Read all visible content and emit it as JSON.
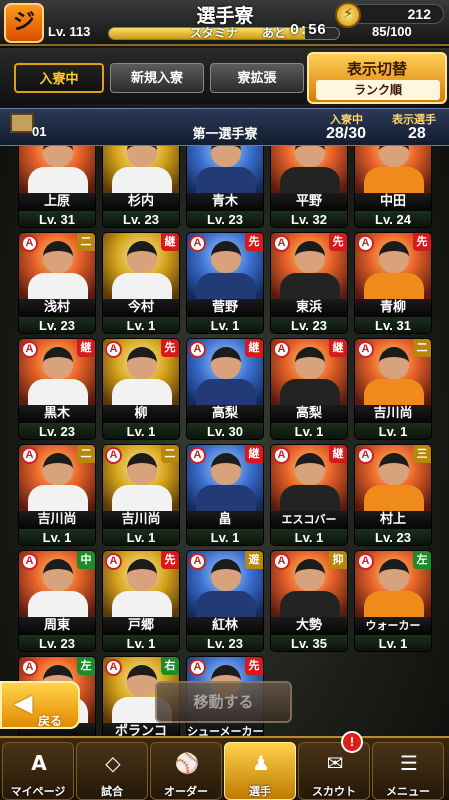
{
  "header": {
    "logo": "ジ",
    "title": "選手寮",
    "level": "Lv. 113",
    "stamina_label": "スタミナ",
    "remaining_label": "あと",
    "timer": "0:56",
    "stamina_value": "85/100",
    "stamina_fraction": 0.85,
    "coins": "212",
    "coin_icon": "coin-icon"
  },
  "tabs": [
    {
      "label": "入寮中",
      "active": true
    },
    {
      "label": "新規入寮",
      "active": false
    },
    {
      "label": "寮拡張",
      "active": false
    }
  ],
  "sort": {
    "title": "表示切替",
    "value": "ランク順"
  },
  "dorm": {
    "number": "01",
    "name": "第一選手寮",
    "occupancy_label": "入寮中",
    "occupancy_value": "28/30",
    "shown_label": "表示選手",
    "shown_value": "28"
  },
  "players": [
    {
      "name": "上原",
      "level": "Lv. 31"
    },
    {
      "name": "杉内",
      "level": "Lv. 23"
    },
    {
      "name": "青木",
      "level": "Lv. 23"
    },
    {
      "name": "平野",
      "level": "Lv. 32"
    },
    {
      "name": "中田",
      "level": "Lv. 24"
    },
    {
      "name": "浅村",
      "level": "Lv. 23",
      "grade": "A",
      "pos": "二"
    },
    {
      "name": "今村",
      "level": "Lv. 1",
      "pos": "継"
    },
    {
      "name": "菅野",
      "level": "Lv. 1",
      "grade": "A",
      "pos": "先"
    },
    {
      "name": "東浜",
      "level": "Lv. 23",
      "grade": "A",
      "pos": "先"
    },
    {
      "name": "青柳",
      "level": "Lv. 31",
      "grade": "A",
      "pos": "先"
    },
    {
      "name": "黒木",
      "level": "Lv. 23",
      "grade": "A",
      "pos": "継"
    },
    {
      "name": "柳",
      "level": "Lv. 1",
      "grade": "A",
      "pos": "先"
    },
    {
      "name": "高梨",
      "level": "Lv. 30",
      "grade": "A",
      "pos": "継"
    },
    {
      "name": "高梨",
      "level": "Lv. 1",
      "grade": "A",
      "pos": "継"
    },
    {
      "name": "吉川尚",
      "level": "Lv. 1",
      "grade": "A",
      "pos": "二"
    },
    {
      "name": "吉川尚",
      "level": "Lv. 1",
      "grade": "A",
      "pos": "二"
    },
    {
      "name": "吉川尚",
      "level": "Lv. 1",
      "grade": "A",
      "pos": "二"
    },
    {
      "name": "畠",
      "level": "Lv. 1",
      "grade": "A",
      "pos": "継"
    },
    {
      "name": "エスコバー",
      "level": "Lv. 1",
      "grade": "A",
      "pos": "継"
    },
    {
      "name": "村上",
      "level": "Lv. 23",
      "grade": "A",
      "pos": "三"
    },
    {
      "name": "周東",
      "level": "Lv. 23",
      "grade": "A",
      "pos": "中"
    },
    {
      "name": "戸郷",
      "level": "Lv. 1",
      "grade": "A",
      "pos": "先"
    },
    {
      "name": "紅林",
      "level": "Lv. 23",
      "grade": "A",
      "pos": "遊"
    },
    {
      "name": "大勢",
      "level": "Lv. 35",
      "grade": "A",
      "pos": "抑"
    },
    {
      "name": "ウォーカー",
      "level": "Lv. 1",
      "grade": "A",
      "pos": "左"
    },
    {
      "name": "",
      "level": "",
      "grade": "A",
      "pos": "左"
    },
    {
      "name": "ポランコ",
      "level": "",
      "grade": "A",
      "pos": "右"
    },
    {
      "name": "シューメーカー",
      "level": "",
      "grade": "A",
      "pos": "先"
    }
  ],
  "back_button": {
    "label": "戻る"
  },
  "move_button": {
    "label": "移動する"
  },
  "nav": [
    {
      "label": "マイページ",
      "icon": "A",
      "active": false
    },
    {
      "label": "試合",
      "icon": "◇",
      "active": false
    },
    {
      "label": "オーダー",
      "icon": "⚾",
      "active": false
    },
    {
      "label": "選手",
      "icon": "♟",
      "active": true
    },
    {
      "label": "スカウト",
      "icon": "✉",
      "active": false
    },
    {
      "label": "メニュー",
      "icon": "☰",
      "active": false
    }
  ],
  "scout_badge": "!"
}
